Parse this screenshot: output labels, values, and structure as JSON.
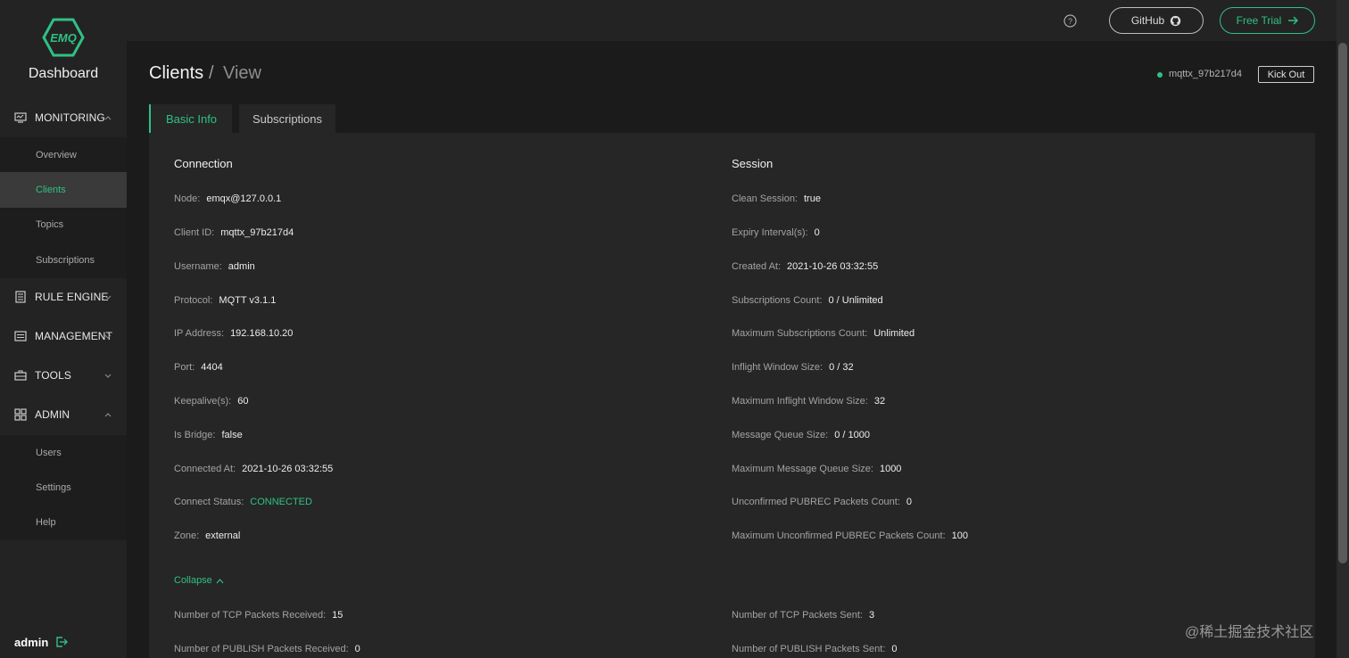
{
  "app": {
    "brand": "Dashboard",
    "logo_text": "EMQ",
    "accent": "#2fc185"
  },
  "sidebar": {
    "groups": [
      {
        "label": "MONITORING",
        "icon": "monitor-icon",
        "expanded": true,
        "items": [
          {
            "label": "Overview",
            "active": false
          },
          {
            "label": "Clients",
            "active": true
          },
          {
            "label": "Topics",
            "active": false
          },
          {
            "label": "Subscriptions",
            "active": false
          }
        ]
      },
      {
        "label": "RULE ENGINE",
        "icon": "document-icon",
        "expanded": false
      },
      {
        "label": "MANAGEMENT",
        "icon": "list-icon",
        "expanded": false
      },
      {
        "label": "TOOLS",
        "icon": "toolbox-icon",
        "expanded": false
      },
      {
        "label": "ADMIN",
        "icon": "grid-icon",
        "expanded": true,
        "items": [
          {
            "label": "Users",
            "active": false
          },
          {
            "label": "Settings",
            "active": false
          },
          {
            "label": "Help",
            "active": false
          }
        ]
      }
    ],
    "user": "admin"
  },
  "topbar": {
    "github_label": "GitHub",
    "trial_label": "Free Trial"
  },
  "header": {
    "title": "Clients",
    "separator": "/",
    "subtitle": "View",
    "client_id": "mqttx_97b217d4",
    "kick_label": "Kick Out"
  },
  "tabs": [
    {
      "label": "Basic Info",
      "active": true
    },
    {
      "label": "Subscriptions",
      "active": false
    }
  ],
  "connection": {
    "title": "Connection",
    "fields": [
      {
        "key": "Node:",
        "value": "emqx@127.0.0.1"
      },
      {
        "key": "Client ID:",
        "value": "mqttx_97b217d4"
      },
      {
        "key": "Username:",
        "value": "admin"
      },
      {
        "key": "Protocol:",
        "value": "MQTT v3.1.1"
      },
      {
        "key": "IP Address:",
        "value": "192.168.10.20"
      },
      {
        "key": "Port:",
        "value": "4404"
      },
      {
        "key": "Keepalive(s):",
        "value": "60"
      },
      {
        "key": "Is Bridge:",
        "value": "false"
      },
      {
        "key": "Connected At:",
        "value": "2021-10-26 03:32:55"
      },
      {
        "key": "Connect Status:",
        "value": "CONNECTED"
      },
      {
        "key": "Zone:",
        "value": "external"
      }
    ]
  },
  "session": {
    "title": "Session",
    "fields": [
      {
        "key": "Clean Session:",
        "value": "true"
      },
      {
        "key": "Expiry Interval(s):",
        "value": "0"
      },
      {
        "key": "Created At:",
        "value": "2021-10-26 03:32:55"
      },
      {
        "key": "Subscriptions Count:",
        "value": "0 / Unlimited"
      },
      {
        "key": "Maximum Subscriptions Count:",
        "value": "Unlimited"
      },
      {
        "key": "Inflight Window Size:",
        "value": "0 / 32"
      },
      {
        "key": "Maximum Inflight Window Size:",
        "value": "32"
      },
      {
        "key": "Message Queue Size:",
        "value": "0 / 1000"
      },
      {
        "key": "Maximum Message Queue Size:",
        "value": "1000"
      },
      {
        "key": "Unconfirmed PUBREC Packets Count:",
        "value": "0"
      },
      {
        "key": "Maximum Unconfirmed PUBREC Packets Count:",
        "value": "100"
      }
    ]
  },
  "collapse_label": "Collapse",
  "stats": {
    "left": [
      {
        "key": "Number of TCP Packets Received:",
        "value": "15"
      },
      {
        "key": "Number of PUBLISH Packets Received:",
        "value": "0"
      }
    ],
    "right": [
      {
        "key": "Number of TCP Packets Sent:",
        "value": "3"
      },
      {
        "key": "Number of PUBLISH Packets Sent:",
        "value": "0"
      }
    ]
  },
  "watermark": "@稀土掘金技术社区"
}
